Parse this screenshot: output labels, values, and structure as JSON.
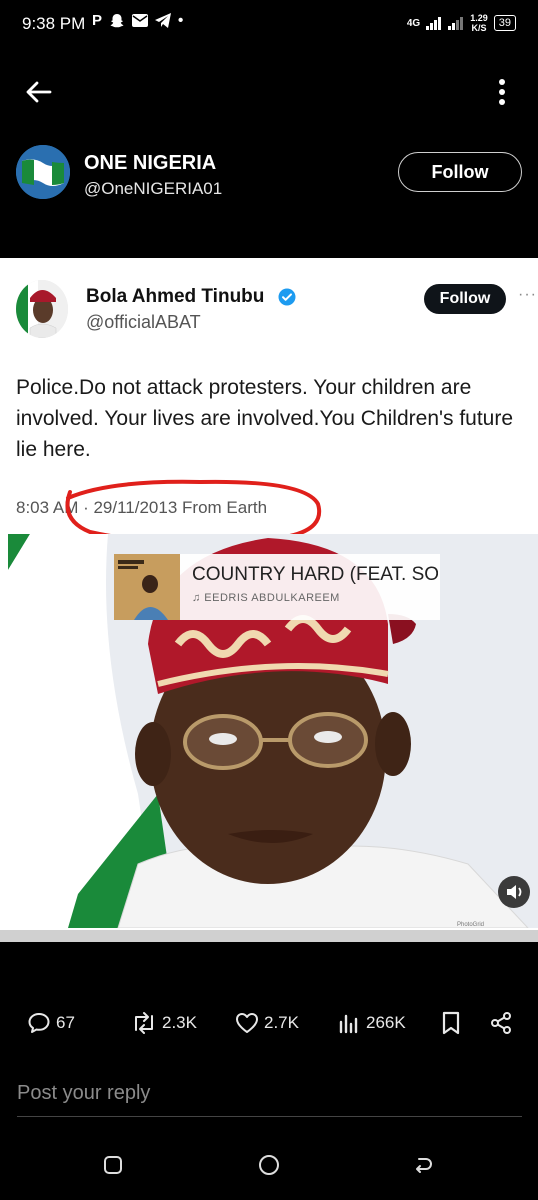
{
  "status_bar": {
    "time": "9:38 PM",
    "app_icons": [
      "P",
      "snapchat-icon",
      "mail-icon",
      "telegram-icon",
      "•"
    ],
    "network": "4G",
    "speed_value": "1.29",
    "speed_unit": "K/S",
    "battery": "39"
  },
  "post": {
    "author_name": "ONE NIGERIA",
    "author_handle": "@OneNIGERIA01",
    "follow_label": "Follow"
  },
  "embedded_tweet": {
    "name": "Bola Ahmed Tinubu",
    "handle": "@officialABAT",
    "follow_label": "Follow",
    "more": "···",
    "text": "Police.Do not attack protesters. Your children are involved. Your lives are involved.You Children's future lie here.",
    "meta": "8:03 AM · 29/11/2013 From Earth",
    "music_title": "COUNTRY HARD (FEAT. SOUN",
    "music_artist": "♫ EEDRIS ABDULKAREEM",
    "watermark": "PhotoGrid"
  },
  "actions": {
    "replies": "67",
    "reposts": "2.3K",
    "likes": "2.7K",
    "views": "266K"
  },
  "reply_placeholder": "Post your reply",
  "colors": {
    "background": "#000000",
    "verified": "#1d9bf0",
    "red_annotation": "#e0201b",
    "flag_green": "#1a8a3a"
  }
}
